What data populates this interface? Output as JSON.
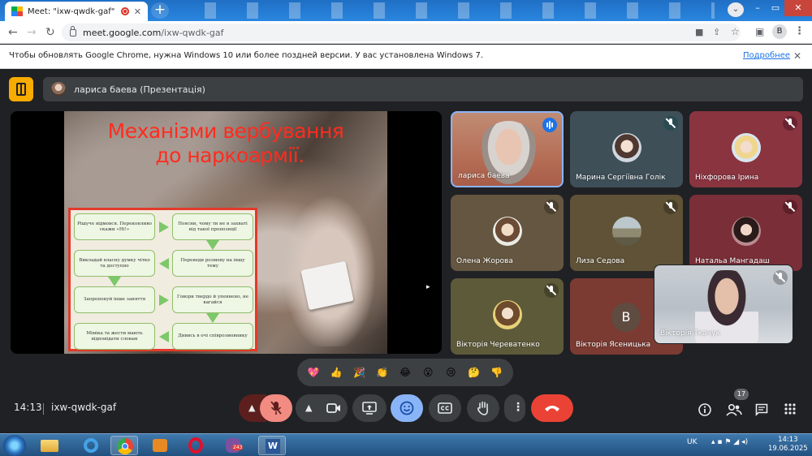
{
  "browser": {
    "tab_title": "Meet: \"ixw-qwdk-gaf\"",
    "url_host": "meet.google.com",
    "url_path": "/ixw-qwdk-gaf",
    "profile_initial": "B",
    "infobar_text": "Чтобы обновлять Google Chrome, нужна Windows 10 или более поздней версии. У вас установлена Windows 7.",
    "infobar_link": "Подробнее"
  },
  "meet": {
    "presenter_label": "лариса баева (Презентація)",
    "slide": {
      "title_line1": "Механізми вербування",
      "title_line2": "до наркоармії.",
      "boxes": [
        "Рішуче відмовся. Переконливо скажи «Ні!»",
        "Поясни, чому ти не в захваті від такої пропозиції",
        "Переведи розмову на іншу тему",
        "Викладай власну думку чітко та доступно",
        "Запропонуй інше заняття",
        "Говори твердо й упевнено, не вагайся",
        "Дивись в очі співрозмовнику",
        "Міміка та жести мають відповідати словам"
      ]
    },
    "participants": [
      {
        "name": "лариса баева",
        "state": "speaking"
      },
      {
        "name": "Марина Сергіївна Голік",
        "state": "muted"
      },
      {
        "name": "Ніхфорова Ірина",
        "state": "muted"
      },
      {
        "name": "Олена Жорова",
        "state": "muted"
      },
      {
        "name": "Лиза Седова",
        "state": "muted"
      },
      {
        "name": "Натальа Мангадаш",
        "state": "muted"
      },
      {
        "name": "Вікторія Череватенко",
        "state": "muted"
      },
      {
        "name": "Вікторія Ясеницька",
        "state": "muted",
        "avatar_letter": "B"
      },
      {
        "name": "Вікторія Ткачук",
        "state": "muted"
      }
    ],
    "reactions": [
      "💖",
      "👍",
      "🎉",
      "👏",
      "😂",
      "😮",
      "😢",
      "🤔",
      "👎"
    ],
    "clock": "14:13",
    "separator": "|",
    "meeting_code": "ixw-qwdk-gaf",
    "people_count": "17",
    "colors": {
      "accent_blue": "#8ab4f8",
      "end_call_red": "#ea4335",
      "pin_yellow": "#f9ab00"
    }
  },
  "taskbar": {
    "language": "UK",
    "time": "14:13",
    "date": "19.06.2025",
    "viber_badge": "243"
  }
}
